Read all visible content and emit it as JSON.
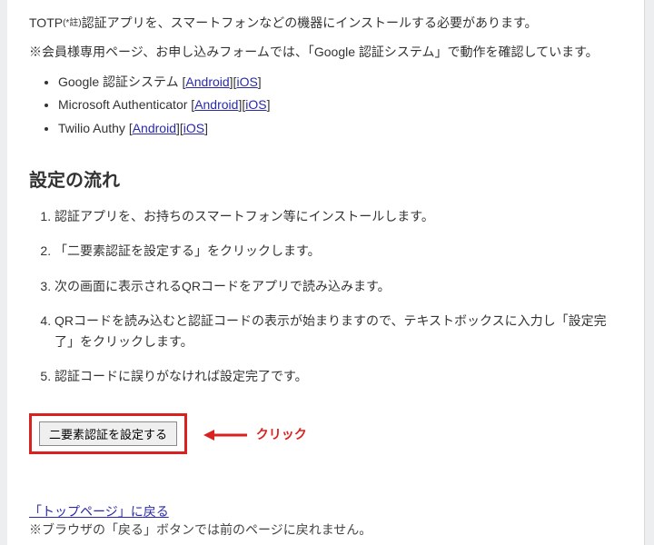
{
  "intro": {
    "line1_prefix": "TOTP",
    "line1_sup": "(*註)",
    "line1_rest": "認証アプリを、スマートフォンなどの機器にインストールする必要があります。",
    "line2": "※会員様専用ページ、お申し込みフォームでは、「Google 認証システム」で動作を確認しています。"
  },
  "apps": [
    {
      "name": "Google 認証システム",
      "links": [
        {
          "label": "Android"
        },
        {
          "label": "iOS"
        }
      ]
    },
    {
      "name": "Microsoft Authenticator",
      "links": [
        {
          "label": "Android"
        },
        {
          "label": "iOS"
        }
      ]
    },
    {
      "name": "Twilio Authy",
      "links": [
        {
          "label": "Android"
        },
        {
          "label": "iOS"
        }
      ]
    }
  ],
  "flow": {
    "heading": "設定の流れ",
    "steps": [
      "認証アプリを、お持ちのスマートフォン等にインストールします。",
      "「二要素認証を設定する」をクリックします。",
      "次の画面に表示されるQRコードをアプリで読み込みます。",
      "QRコードを読み込むと認証コードの表示が始まりますので、テキストボックスに入力し「設定完了」をクリックします。",
      "認証コードに誤りがなければ設定完了です。"
    ]
  },
  "action": {
    "button_label": "二要素認証を設定する",
    "click_label": "クリック"
  },
  "footer": {
    "back_link": "「トップページ」に戻る",
    "note": "※ブラウザの「戻る」ボタンでは前のページに戻れません。"
  }
}
